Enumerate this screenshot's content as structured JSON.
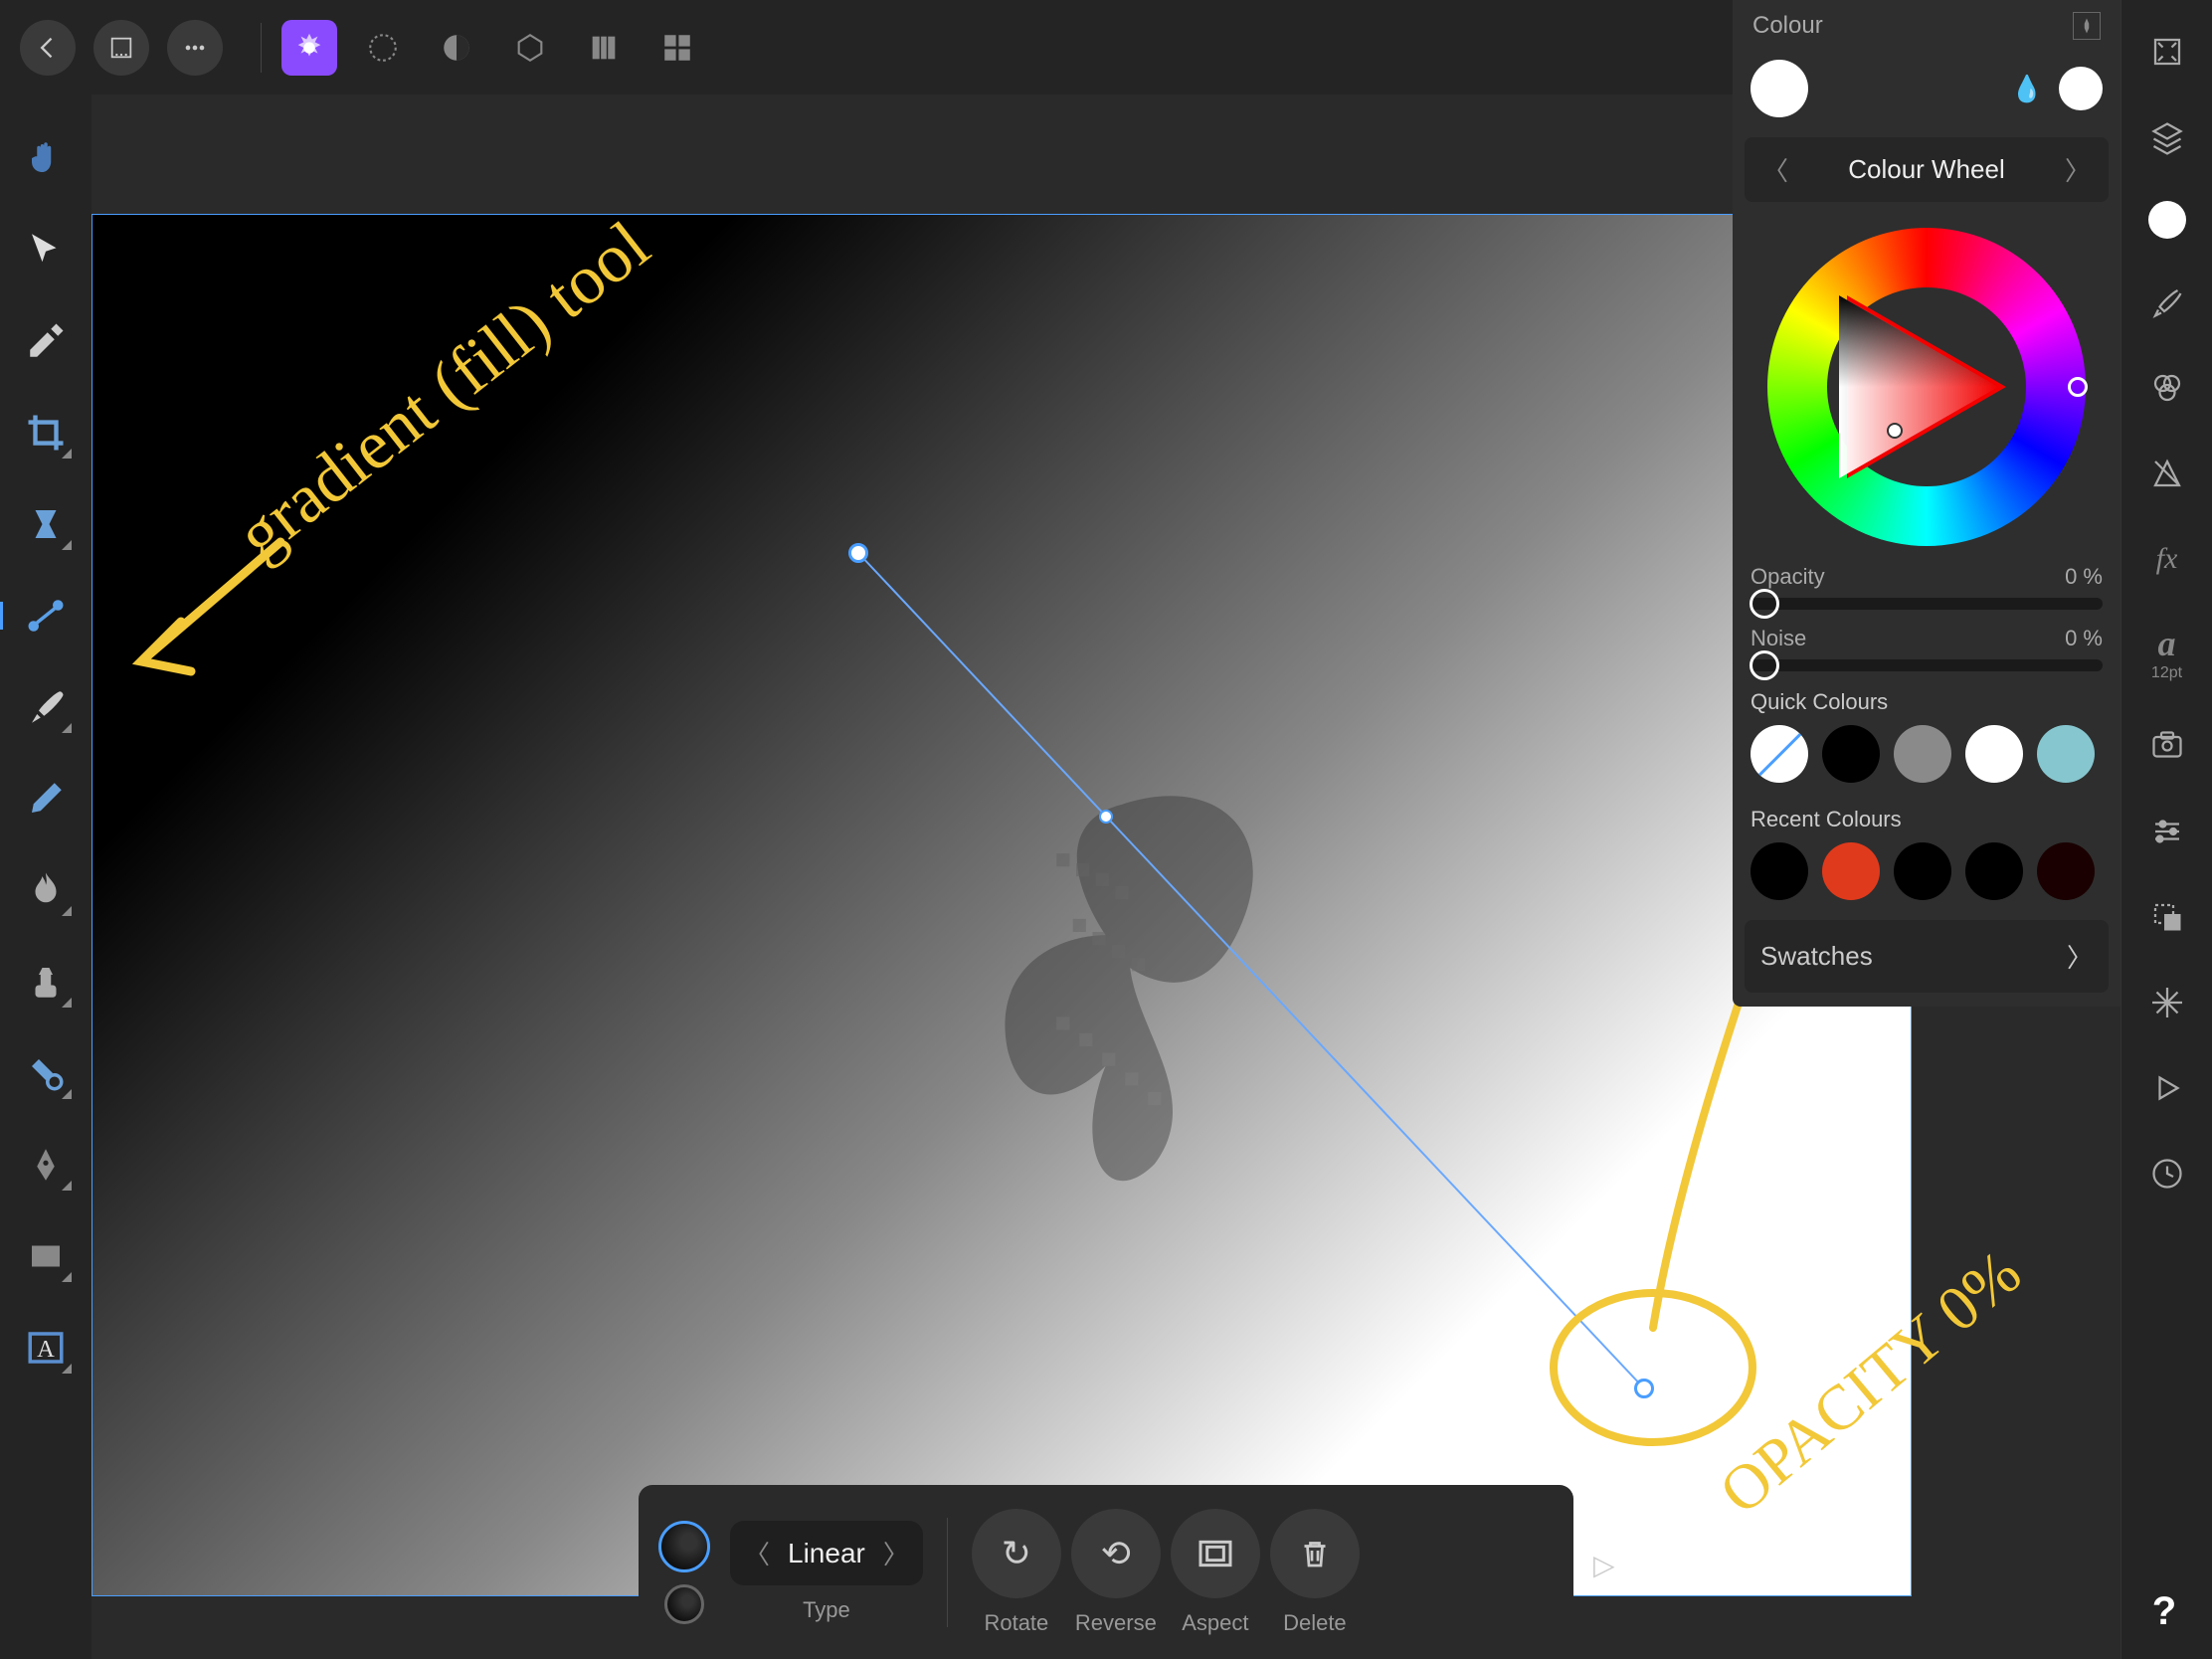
{
  "topbar": {},
  "left_tools": [
    {
      "name": "hand-tool"
    },
    {
      "name": "move-tool"
    },
    {
      "name": "color-picker-tool"
    },
    {
      "name": "crop-tool"
    },
    {
      "name": "selection-tool"
    },
    {
      "name": "gradient-tool"
    },
    {
      "name": "paint-brush-tool"
    },
    {
      "name": "pencil-tool"
    },
    {
      "name": "burn-tool"
    },
    {
      "name": "clone-tool"
    },
    {
      "name": "healing-tool"
    },
    {
      "name": "pen-tool"
    },
    {
      "name": "rectangle-tool"
    },
    {
      "name": "text-tool"
    }
  ],
  "right_bar": {
    "text_size": "12pt"
  },
  "color_panel": {
    "title": "Colour",
    "mode_label": "Colour Wheel",
    "opacity": {
      "label": "Opacity",
      "value": "0 %",
      "percent": 0
    },
    "noise": {
      "label": "Noise",
      "value": "0 %",
      "percent": 0
    },
    "quick_title": "Quick Colours",
    "quick": [
      {
        "name": "none",
        "css": "none"
      },
      {
        "name": "black",
        "css": "#000"
      },
      {
        "name": "grey",
        "css": "#8a8a8a"
      },
      {
        "name": "white",
        "css": "#fff"
      },
      {
        "name": "teal",
        "css": "#86c6cf"
      }
    ],
    "recent_title": "Recent Colours",
    "recent": [
      {
        "css": "#000"
      },
      {
        "css": "#e03a1c"
      },
      {
        "css": "#000"
      },
      {
        "css": "#000"
      },
      {
        "css": "#1a0000"
      }
    ],
    "swatches_label": "Swatches"
  },
  "context_bar": {
    "type_value": "Linear",
    "type_label": "Type",
    "actions": [
      {
        "name": "rotate",
        "label": "Rotate",
        "glyph": "↻"
      },
      {
        "name": "reverse",
        "label": "Reverse",
        "glyph": "↶"
      },
      {
        "name": "aspect",
        "label": "Aspect",
        "glyph": "◫"
      },
      {
        "name": "delete",
        "label": "Delete",
        "glyph": "🗑"
      }
    ]
  },
  "annotations": {
    "gradient_text": "gradient (fill) tool",
    "opacity_text": "OPACITY 0%"
  }
}
